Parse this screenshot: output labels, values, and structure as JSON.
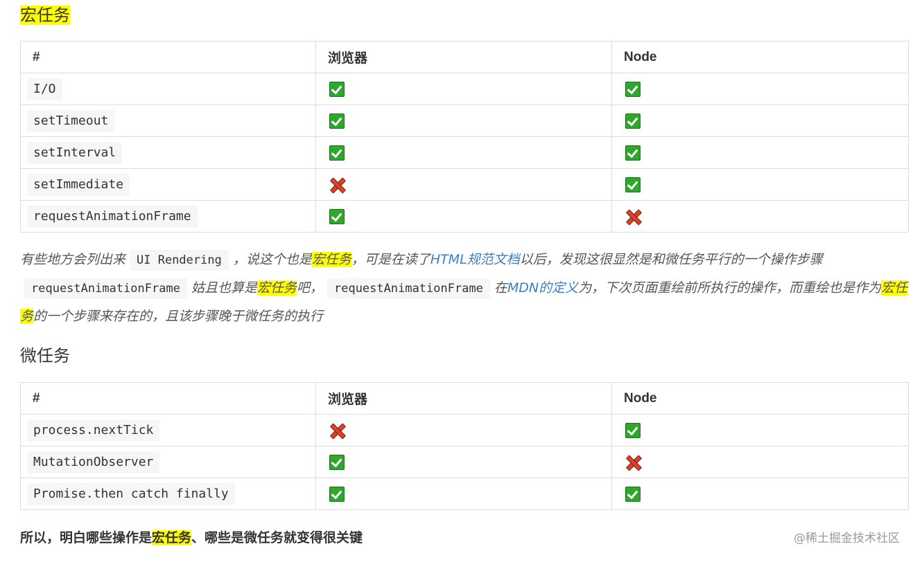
{
  "macro": {
    "heading": "宏任务",
    "headers": [
      "#",
      "浏览器",
      "Node"
    ],
    "rows": [
      {
        "name": "I/O",
        "browser": "check",
        "node": "check"
      },
      {
        "name": "setTimeout",
        "browser": "check",
        "node": "check"
      },
      {
        "name": "setInterval",
        "browser": "check",
        "node": "check"
      },
      {
        "name": "setImmediate",
        "browser": "cross",
        "node": "check"
      },
      {
        "name": "requestAnimationFrame",
        "browser": "check",
        "node": "cross"
      }
    ]
  },
  "paragraph": {
    "t1": "有些地方会列出来",
    "code1": "UI Rendering",
    "t2": "，说这个也是",
    "hl1": "宏任务",
    "t3": "，可是在读了",
    "link1": "HTML规范文档",
    "t4": "以后，发现这很显然是和微任务平行的一个操作步骤",
    "code2": "requestAnimationFrame",
    "t5": "姑且也算是",
    "hl2": "宏任务",
    "t6": "吧，",
    "code3": "requestAnimationFrame",
    "t7": "在",
    "link2": "MDN的定义",
    "t8": "为，下次页面重绘前所执行的操作，而重绘也是作为",
    "hl3": "宏任务",
    "t9": "的一个步骤来存在的，且该步骤晚于微任务的执行"
  },
  "micro": {
    "heading": "微任务",
    "headers": [
      "#",
      "浏览器",
      "Node"
    ],
    "rows": [
      {
        "name": "process.nextTick",
        "browser": "cross",
        "node": "check"
      },
      {
        "name": "MutationObserver",
        "browser": "check",
        "node": "cross"
      },
      {
        "name": "Promise.then catch finally",
        "browser": "check",
        "node": "check"
      }
    ]
  },
  "conclusion": {
    "pre": "所以，明白哪些操作是",
    "hl": "宏任务",
    "post": "、哪些是微任务就变得很关键"
  },
  "watermark": "@稀土掘金技术社区",
  "colors": {
    "highlight": "#ffff00",
    "link": "#3d7ec2",
    "check": "#2fa62c",
    "cross": "#d8442a"
  }
}
